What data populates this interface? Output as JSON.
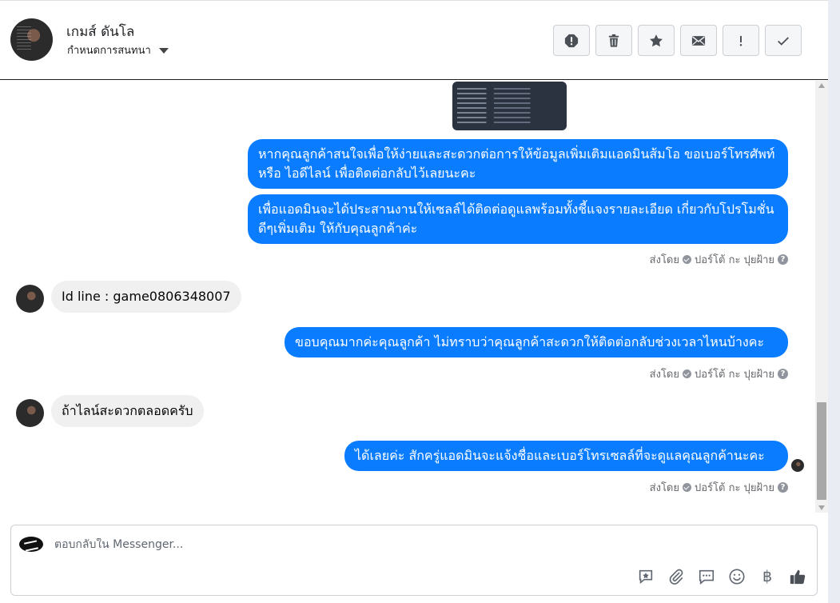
{
  "header": {
    "contact_name": "เกมส์ ดันโล",
    "conversation_settings": "กำหนดการสนทนา",
    "toolbar": [
      {
        "name": "spam-report-button",
        "icon": "alert-circle-icon"
      },
      {
        "name": "delete-button",
        "icon": "trash-icon"
      },
      {
        "name": "star-button",
        "icon": "star-icon"
      },
      {
        "name": "mark-unread-button",
        "icon": "envelope-icon"
      },
      {
        "name": "follow-up-button",
        "icon": "exclamation-icon"
      },
      {
        "name": "mark-done-button",
        "icon": "check-icon"
      }
    ]
  },
  "messages": {
    "m1": "หากคุณลูกค้าสนใจเพื่อให้ง่ายและสะดวกต่อการให้ข้อมูลเพิ่มเติมแอดมินส้มโอ ขอเบอร์โทรศัพท์ หรือ ไอดีไลน์ เพื่อติดต่อกลับไว้เลยนะคะ",
    "m2": "เพื่อแอดมินจะได้ประสานงานให้เซลล์ได้ติดต่อดูแลพร้อมทั้งชี้แจงรายละเอียด เกี่ยวกับโปรโมชั่นดีๆเพิ่มเติม ให้กับคุณลูกค้าค่ะ",
    "m3": "Id line : game0806348007",
    "m4": "ขอบคุณมากค่ะคุณลูกค้า ไม่ทราบว่าคุณลูกค้าสะดวกให้ติดต่อกลับช่วงเวลาไหนบ้างคะ",
    "m5": "ถ้าไลน์สะดวกตลอดครับ",
    "m6": "ได้เลยค่ะ สักครู่แอดมินจะแจ้งชื่อและเบอร์โทรเซลล์ที่จะดูแลคุณลูกค้านะคะ",
    "sent_by_prefix": "ส่งโดย",
    "sender_name": "ปอร์โต้ กะ ปุยฝ้าย",
    "help_glyph": "?"
  },
  "composer": {
    "placeholder": "ตอบกลับใน Messenger...",
    "icons": [
      "saved-reply-icon",
      "attachment-icon",
      "chat-bubble-icon",
      "emoji-icon",
      "baht-payment-icon",
      "like-icon"
    ],
    "baht_symbol": "฿"
  }
}
